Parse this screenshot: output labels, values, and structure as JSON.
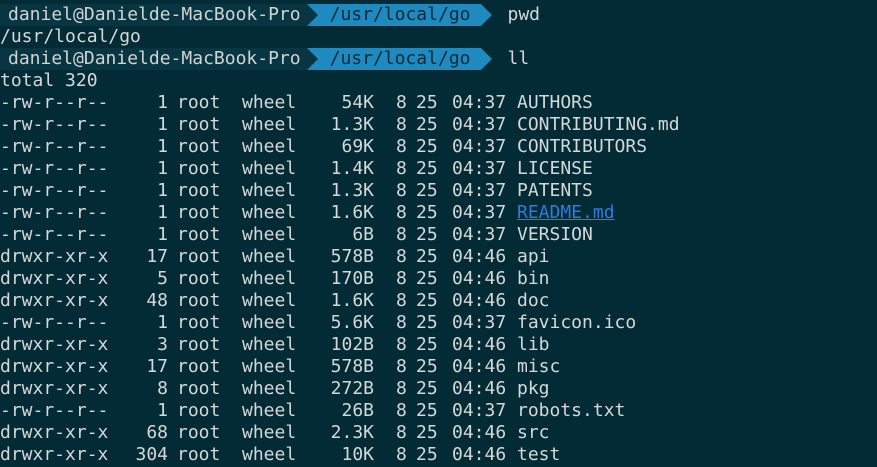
{
  "prompts": [
    {
      "host": "daniel@Danielde-MacBook-Pro",
      "cwd": "/usr/local/go",
      "command": "pwd"
    },
    {
      "host": "daniel@Danielde-MacBook-Pro",
      "cwd": "/usr/local/go",
      "command": "ll"
    }
  ],
  "pwd_output": "/usr/local/go",
  "total_line": "total 320",
  "colors": {
    "background": "#022b35",
    "host_segment": "#073642",
    "cwd_segment": "#1f8ac0",
    "link": "#2a7de1"
  },
  "listing": [
    {
      "perm": "-rw-r--r--",
      "links": "1",
      "owner": "root",
      "group": "wheel",
      "size": "54K",
      "mon": "8",
      "day": "25",
      "time": "04:37",
      "name": "AUTHORS",
      "is_link": false
    },
    {
      "perm": "-rw-r--r--",
      "links": "1",
      "owner": "root",
      "group": "wheel",
      "size": "1.3K",
      "mon": "8",
      "day": "25",
      "time": "04:37",
      "name": "CONTRIBUTING.md",
      "is_link": false
    },
    {
      "perm": "-rw-r--r--",
      "links": "1",
      "owner": "root",
      "group": "wheel",
      "size": "69K",
      "mon": "8",
      "day": "25",
      "time": "04:37",
      "name": "CONTRIBUTORS",
      "is_link": false
    },
    {
      "perm": "-rw-r--r--",
      "links": "1",
      "owner": "root",
      "group": "wheel",
      "size": "1.4K",
      "mon": "8",
      "day": "25",
      "time": "04:37",
      "name": "LICENSE",
      "is_link": false
    },
    {
      "perm": "-rw-r--r--",
      "links": "1",
      "owner": "root",
      "group": "wheel",
      "size": "1.3K",
      "mon": "8",
      "day": "25",
      "time": "04:37",
      "name": "PATENTS",
      "is_link": false
    },
    {
      "perm": "-rw-r--r--",
      "links": "1",
      "owner": "root",
      "group": "wheel",
      "size": "1.6K",
      "mon": "8",
      "day": "25",
      "time": "04:37",
      "name": "README.md",
      "is_link": true
    },
    {
      "perm": "-rw-r--r--",
      "links": "1",
      "owner": "root",
      "group": "wheel",
      "size": "6B",
      "mon": "8",
      "day": "25",
      "time": "04:37",
      "name": "VERSION",
      "is_link": false
    },
    {
      "perm": "drwxr-xr-x",
      "links": "17",
      "owner": "root",
      "group": "wheel",
      "size": "578B",
      "mon": "8",
      "day": "25",
      "time": "04:46",
      "name": "api",
      "is_link": false
    },
    {
      "perm": "drwxr-xr-x",
      "links": "5",
      "owner": "root",
      "group": "wheel",
      "size": "170B",
      "mon": "8",
      "day": "25",
      "time": "04:46",
      "name": "bin",
      "is_link": false
    },
    {
      "perm": "drwxr-xr-x",
      "links": "48",
      "owner": "root",
      "group": "wheel",
      "size": "1.6K",
      "mon": "8",
      "day": "25",
      "time": "04:46",
      "name": "doc",
      "is_link": false
    },
    {
      "perm": "-rw-r--r--",
      "links": "1",
      "owner": "root",
      "group": "wheel",
      "size": "5.6K",
      "mon": "8",
      "day": "25",
      "time": "04:37",
      "name": "favicon.ico",
      "is_link": false
    },
    {
      "perm": "drwxr-xr-x",
      "links": "3",
      "owner": "root",
      "group": "wheel",
      "size": "102B",
      "mon": "8",
      "day": "25",
      "time": "04:46",
      "name": "lib",
      "is_link": false
    },
    {
      "perm": "drwxr-xr-x",
      "links": "17",
      "owner": "root",
      "group": "wheel",
      "size": "578B",
      "mon": "8",
      "day": "25",
      "time": "04:46",
      "name": "misc",
      "is_link": false
    },
    {
      "perm": "drwxr-xr-x",
      "links": "8",
      "owner": "root",
      "group": "wheel",
      "size": "272B",
      "mon": "8",
      "day": "25",
      "time": "04:46",
      "name": "pkg",
      "is_link": false
    },
    {
      "perm": "-rw-r--r--",
      "links": "1",
      "owner": "root",
      "group": "wheel",
      "size": "26B",
      "mon": "8",
      "day": "25",
      "time": "04:37",
      "name": "robots.txt",
      "is_link": false
    },
    {
      "perm": "drwxr-xr-x",
      "links": "68",
      "owner": "root",
      "group": "wheel",
      "size": "2.3K",
      "mon": "8",
      "day": "25",
      "time": "04:46",
      "name": "src",
      "is_link": false
    },
    {
      "perm": "drwxr-xr-x",
      "links": "304",
      "owner": "root",
      "group": "wheel",
      "size": "10K",
      "mon": "8",
      "day": "25",
      "time": "04:46",
      "name": "test",
      "is_link": false
    }
  ]
}
